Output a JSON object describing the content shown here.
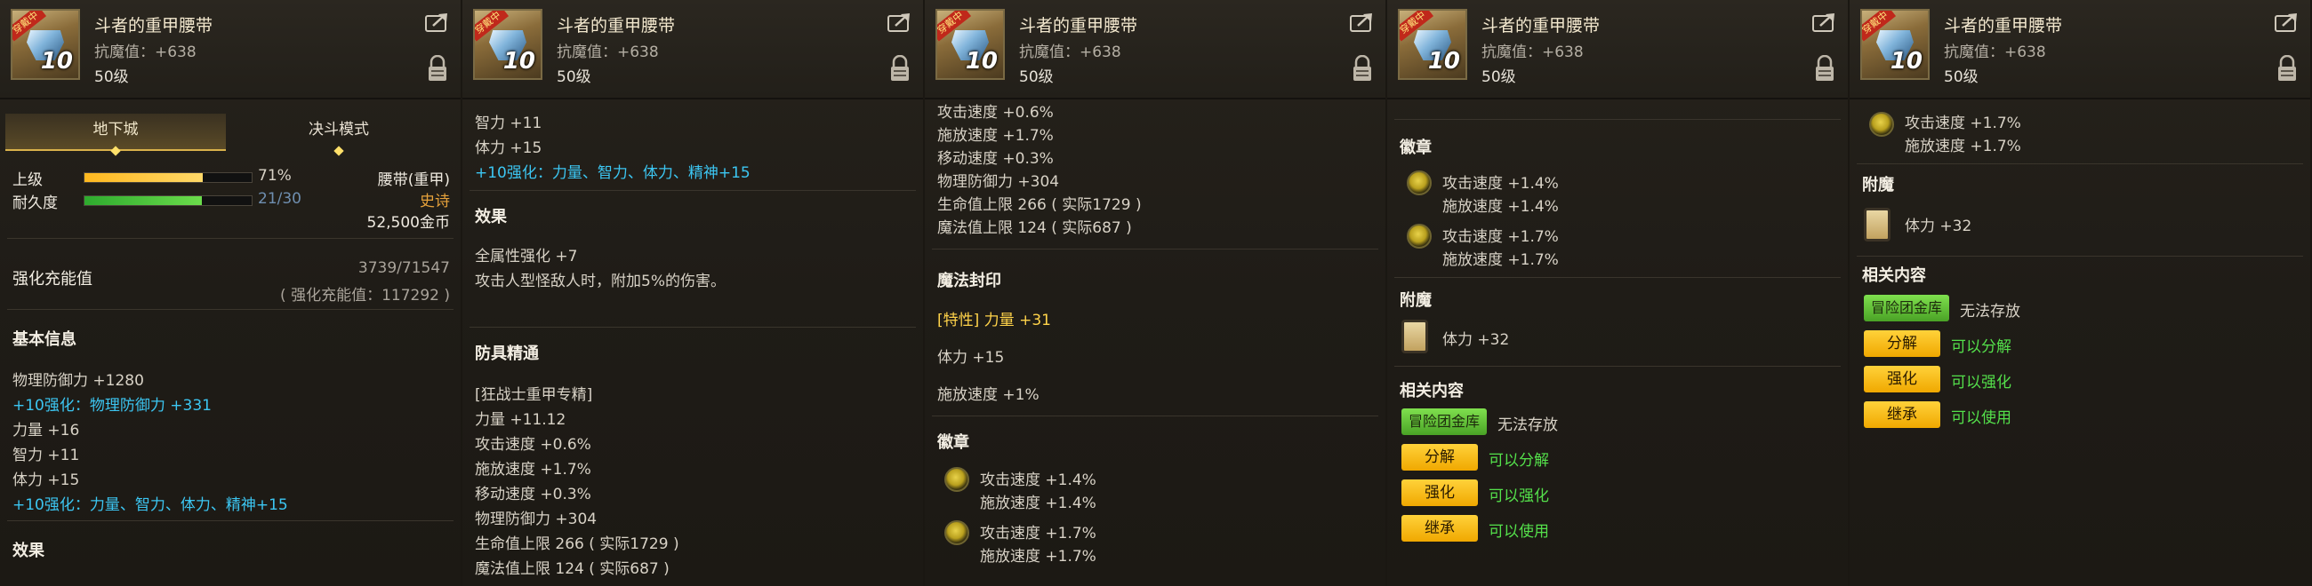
{
  "item": {
    "name": "斗者的重甲腰带",
    "resist": "抗魔值：+638",
    "level": "50级",
    "badge": "穿戴中",
    "enhance": "10"
  },
  "panel1": {
    "tabs": [
      "地下城",
      "决斗模式"
    ],
    "grade_label": "上级",
    "grade_value": "71%",
    "grade_fraction": 0.71,
    "durability_label": "耐久度",
    "durability_value": "21/30",
    "durability_fraction": 0.7,
    "slot_type": "腰带(重甲)",
    "rarity": "史诗",
    "price": "52,500金币",
    "charge_title": "强化充能值",
    "charge_value": "3739/71547",
    "charge_note": "( 强化充能值：117292 )",
    "basic_title": "基本信息",
    "stats": [
      {
        "text": "物理防御力 +1280",
        "style": "normal"
      },
      {
        "text": "+10强化：物理防御力 +331",
        "style": "cyan"
      },
      {
        "text": "力量 +16",
        "style": "normal"
      },
      {
        "text": "智力 +11",
        "style": "normal"
      },
      {
        "text": "体力 +15",
        "style": "normal"
      },
      {
        "text": "+10强化：力量、智力、体力、精神+15",
        "style": "cyan"
      }
    ],
    "effect_title": "效果"
  },
  "panel2": {
    "lines_top": [
      "智力 +11",
      "体力 +15"
    ],
    "cyan_line": "+10强化：力量、智力、体力、精神+15",
    "effect_title": "效果",
    "effects": [
      "全属性强化 +7",
      "攻击人型怪敌人时，附加5%的伤害。"
    ],
    "mastery_title": "防具精通",
    "mastery_lines": [
      "[狂战士重甲专精]",
      "力量 +11.12",
      "攻击速度 +0.6%",
      "施放速度 +1.7%",
      "移动速度 +0.3%",
      "物理防御力 +304",
      "生命值上限 266 ( 实际1729 )",
      "魔法值上限 124 ( 实际687 )"
    ]
  },
  "panel3": {
    "lines_top": [
      "攻击速度 +0.6%",
      "施放速度 +1.7%",
      "移动速度 +0.3%",
      "物理防御力 +304",
      "生命值上限 266 ( 实际1729 )",
      "魔法值上限 124 ( 实际687 )"
    ],
    "seal_title": "魔法封印",
    "seal_lines": [
      "[特性] 力量 +31",
      "体力 +15",
      "施放速度 +1%"
    ],
    "emblem_title": "徽章",
    "emblems": [
      {
        "line1": "攻击速度 +1.4%",
        "line2": "施放速度 +1.4%"
      },
      {
        "line1": "攻击速度 +1.7%",
        "line2": "施放速度 +1.7%"
      }
    ]
  },
  "panel4": {
    "emblem_title": "徽章",
    "emblems": [
      {
        "line1": "攻击速度 +1.4%",
        "line2": "施放速度 +1.4%"
      },
      {
        "line1": "攻击速度 +1.7%",
        "line2": "施放速度 +1.7%"
      }
    ],
    "enchant_title": "附魔",
    "enchant_value": "体力 +32",
    "related_title": "相关内容",
    "storage_label": "冒险团金库",
    "storage_value": "无法存放",
    "actions": [
      {
        "label": "分解",
        "value": "可以分解"
      },
      {
        "label": "强化",
        "value": "可以强化"
      },
      {
        "label": "继承",
        "value": "可以使用"
      }
    ]
  },
  "panel5": {
    "emblem": {
      "line1": "攻击速度 +1.7%",
      "line2": "施放速度 +1.7%"
    },
    "enchant_title": "附魔",
    "enchant_value": "体力 +32",
    "related_title": "相关内容",
    "storage_label": "冒险团金库",
    "storage_value": "无法存放",
    "actions": [
      {
        "label": "分解",
        "value": "可以分解"
      },
      {
        "label": "强化",
        "value": "可以强化"
      },
      {
        "label": "继承",
        "value": "可以使用"
      }
    ]
  }
}
